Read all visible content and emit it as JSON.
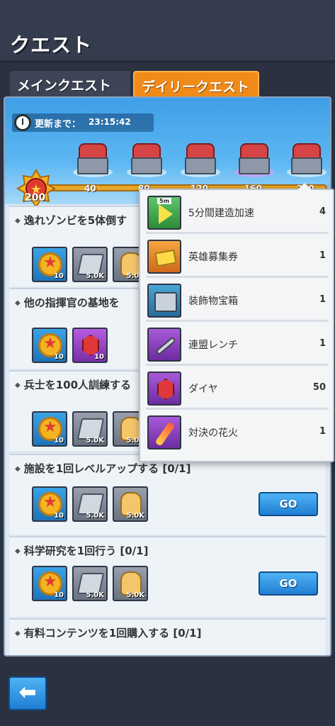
{
  "header": {
    "title": "クエスト"
  },
  "tabs": [
    {
      "label": "メインクエスト"
    },
    {
      "label": "デイリークエスト"
    }
  ],
  "timer": {
    "label": "更新まで：",
    "value": "23:15:42"
  },
  "progress": {
    "current_points": "200",
    "milestones": [
      "40",
      "80",
      "120",
      "160",
      "200"
    ]
  },
  "quests": [
    {
      "title": "逸れゾンビを5体倒す",
      "rewards": [
        "10",
        "5.0K",
        "5.0K"
      ]
    },
    {
      "title": "他の指揮官の基地を",
      "rewards": [
        "10",
        "10"
      ]
    },
    {
      "title": "兵士を100人訓練する",
      "rewards": [
        "10",
        "5.0K",
        "5.0K"
      ]
    },
    {
      "title": "施設を1回レベルアップする [0/1]",
      "rewards": [
        "10",
        "5.0K",
        "5.0K"
      ],
      "go_label": "GO"
    },
    {
      "title": "科学研究を1回行う [0/1]",
      "rewards": [
        "10",
        "5.0K",
        "5.0K"
      ],
      "go_label": "GO"
    },
    {
      "title": "有料コンテンツを1回購入する [0/1]",
      "rewards": []
    }
  ],
  "popup": {
    "icon_badge": "5m",
    "items": [
      {
        "name": "5分間建造加速",
        "qty": "4",
        "icon": "speedup-icon",
        "color": "#3fae4a"
      },
      {
        "name": "英雄募集券",
        "qty": "1",
        "icon": "ticket-icon",
        "color": "#f08a19"
      },
      {
        "name": "装飾物宝箱",
        "qty": "1",
        "icon": "decoration-box-icon",
        "color": "#3d8fc4"
      },
      {
        "name": "連盟レンチ",
        "qty": "1",
        "icon": "wrench-icon",
        "color": "#8f44c2"
      },
      {
        "name": "ダイヤ",
        "qty": "50",
        "icon": "diamond-icon",
        "color": "#8f44c2"
      },
      {
        "name": "対決の花火",
        "qty": "1",
        "icon": "firework-icon",
        "color": "#8f44c2"
      }
    ]
  },
  "back_button": {
    "icon": "back-arrow-icon"
  }
}
